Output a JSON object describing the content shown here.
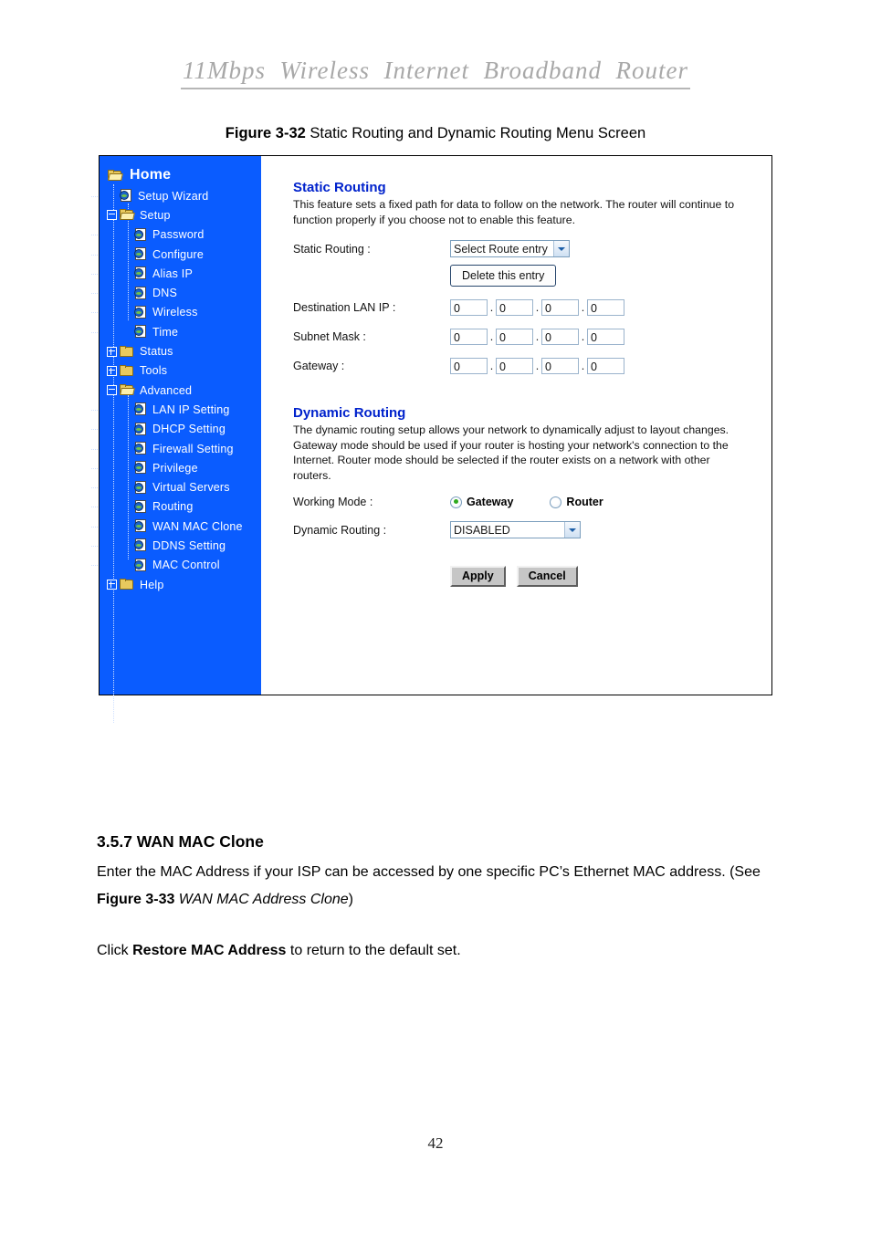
{
  "document": {
    "running_header": "11Mbps  Wireless  Internet  Broadband  Router",
    "page_number": "42",
    "figure_caption_lead": "Figure 3-32",
    "figure_caption_text": " Static Routing and Dynamic Routing Menu Screen"
  },
  "sidebar": {
    "home_label": "Home",
    "items": [
      {
        "label": "Setup Wizard",
        "level": 1,
        "icon": "page-globe-icon"
      },
      {
        "label": "Setup",
        "level": 1,
        "icon": "folder-open-icon",
        "expander": "minus"
      },
      {
        "label": "Password",
        "level": 2,
        "icon": "page-globe-icon"
      },
      {
        "label": "Configure",
        "level": 2,
        "icon": "page-globe-icon"
      },
      {
        "label": "Alias IP",
        "level": 2,
        "icon": "page-globe-icon"
      },
      {
        "label": "DNS",
        "level": 2,
        "icon": "page-globe-icon"
      },
      {
        "label": "Wireless",
        "level": 2,
        "icon": "page-globe-icon"
      },
      {
        "label": "Time",
        "level": 2,
        "icon": "page-globe-icon"
      },
      {
        "label": "Status",
        "level": 1,
        "icon": "folder-closed-icon",
        "expander": "plus"
      },
      {
        "label": "Tools",
        "level": 1,
        "icon": "folder-closed-icon",
        "expander": "plus"
      },
      {
        "label": "Advanced",
        "level": 1,
        "icon": "folder-open-icon",
        "expander": "minus"
      },
      {
        "label": "LAN IP Setting",
        "level": 2,
        "icon": "page-globe-icon"
      },
      {
        "label": "DHCP Setting",
        "level": 2,
        "icon": "page-globe-icon"
      },
      {
        "label": "Firewall Setting",
        "level": 2,
        "icon": "page-globe-icon"
      },
      {
        "label": "Privilege",
        "level": 2,
        "icon": "page-globe-icon"
      },
      {
        "label": "Virtual Servers",
        "level": 2,
        "icon": "page-globe-icon"
      },
      {
        "label": "Routing",
        "level": 2,
        "icon": "page-globe-icon"
      },
      {
        "label": "WAN MAC Clone",
        "level": 2,
        "icon": "page-globe-icon"
      },
      {
        "label": "DDNS Setting",
        "level": 2,
        "icon": "page-globe-icon"
      },
      {
        "label": "MAC Control",
        "level": 2,
        "icon": "page-globe-icon"
      },
      {
        "label": "Help",
        "level": 1,
        "icon": "folder-closed-icon",
        "expander": "plus"
      }
    ]
  },
  "static_routing": {
    "heading": "Static Routing",
    "description": "This feature sets a fixed path for data to follow on the network. The router will continue to function properly if you choose not to enable this feature.",
    "select_label": "Static Routing :",
    "select_value": "Select Route entry",
    "delete_button": "Delete this entry",
    "fields": [
      {
        "label": "Destination LAN IP :",
        "octets": [
          "0",
          "0",
          "0",
          "0"
        ]
      },
      {
        "label": "Subnet Mask :",
        "octets": [
          "0",
          "0",
          "0",
          "0"
        ]
      },
      {
        "label": "Gateway :",
        "octets": [
          "0",
          "0",
          "0",
          "0"
        ]
      }
    ]
  },
  "dynamic_routing": {
    "heading": "Dynamic Routing",
    "description": "The dynamic routing setup allows your network to dynamically adjust to layout changes. Gateway mode should be used if your router is hosting your network's connection to the Internet. Router mode should be selected if the router exists on a network with other routers.",
    "working_mode_label": "Working Mode :",
    "mode_options": [
      {
        "label": "Gateway",
        "selected": true
      },
      {
        "label": "Router",
        "selected": false
      }
    ],
    "dynamic_routing_label": "Dynamic Routing :",
    "dynamic_routing_value": "DISABLED",
    "apply_button": "Apply",
    "cancel_button": "Cancel"
  },
  "prose": {
    "section_heading": "3.5.7 WAN MAC Clone",
    "para1_a": "Enter the MAC Address if your ISP can be accessed by one specific PC’s Ethernet MAC address. (See ",
    "para1_bold": "Figure 3-33",
    "para1_italic": " WAN MAC Address Clone",
    "para1_c": ")",
    "para2_a": "Click ",
    "para2_bold": "Restore MAC Address",
    "para2_c": " to return to the default set."
  },
  "colors": {
    "sidebar_blue": "#0A5CFF",
    "heading_blue": "#0022CC",
    "header_gray": "#a8a8a8",
    "radio_green": "#2faa1e"
  }
}
